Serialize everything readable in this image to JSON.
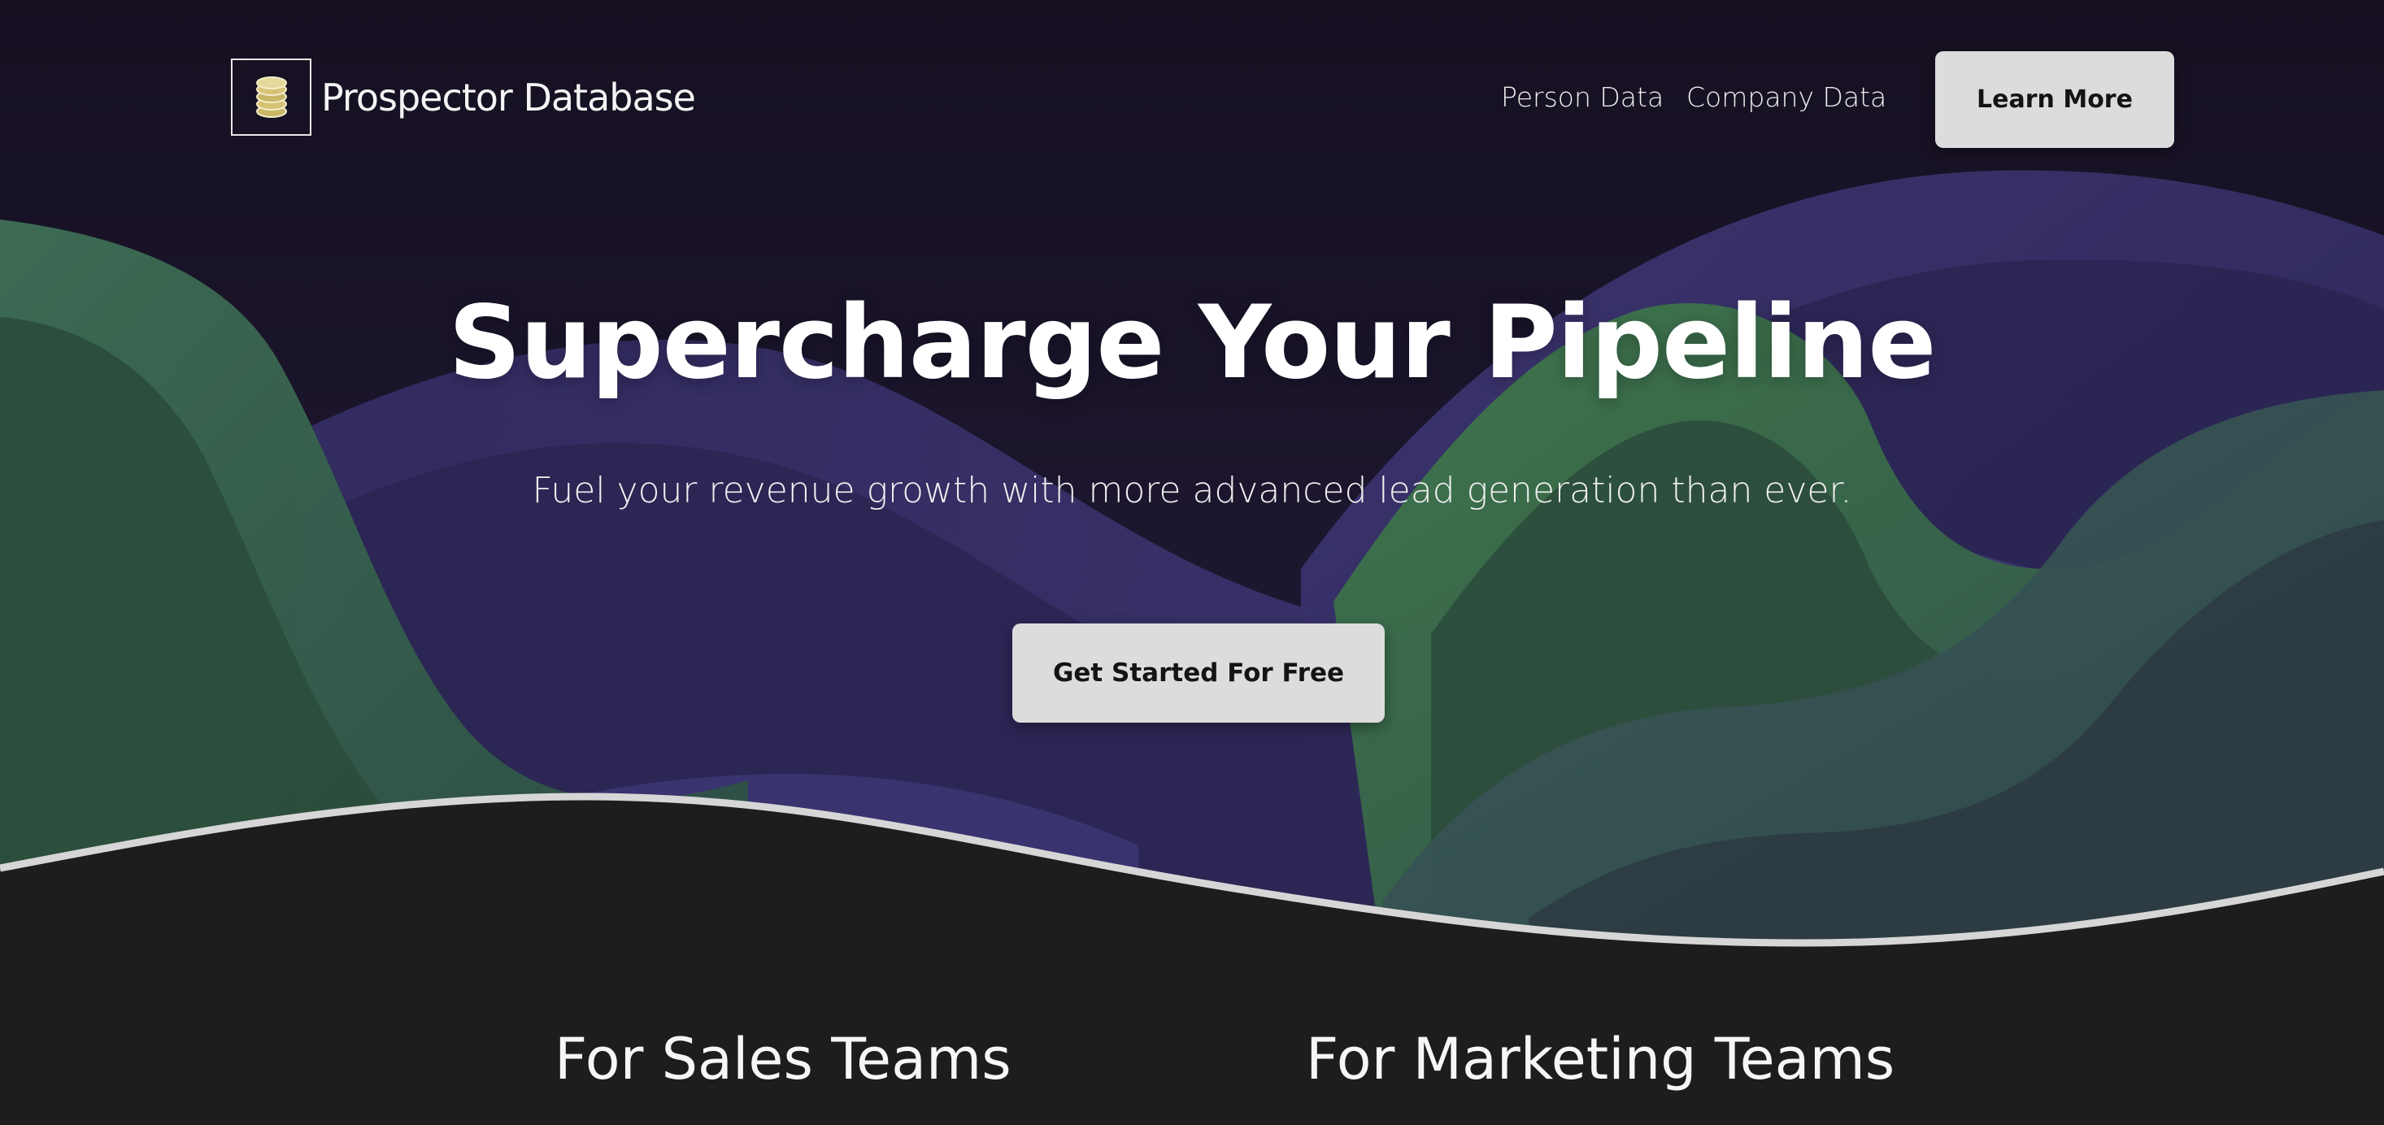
{
  "brand": {
    "name": "Prospector Database",
    "logo_icon": "coin-stack-icon"
  },
  "nav": {
    "links": [
      {
        "label": "Person Data"
      },
      {
        "label": "Company Data"
      }
    ],
    "cta_label": "Learn More"
  },
  "hero": {
    "title": "Supercharge Your Pipeline",
    "subtitle": "Fuel your revenue growth with more advanced lead generation than ever.",
    "cta_label": "Get Started For Free"
  },
  "sections": {
    "sales_heading": "For Sales Teams",
    "marketing_heading": "For Marketing Teams"
  },
  "colors": {
    "background_dark": "#1d1d1d",
    "hero_deep": "#1a1428",
    "wave_purple": "#3a3470",
    "wave_green": "#3a6b4c",
    "button_bg": "#dcdcdc",
    "divider_line": "#d6d6d6"
  }
}
